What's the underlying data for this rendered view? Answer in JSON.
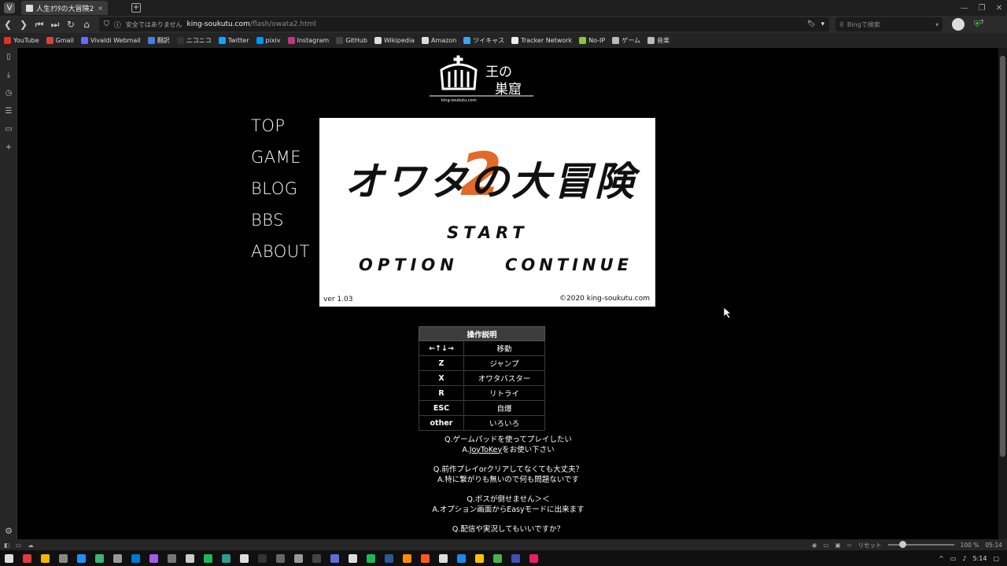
{
  "tab": {
    "title": "人生ｵﾜﾀの大冒険2",
    "close": "×",
    "new_tab": "+"
  },
  "window": {
    "minimize": "—",
    "maximize": "❐",
    "close": "✕"
  },
  "address": {
    "security_label": "安全ではありません",
    "url_host": "king-soukutu.com",
    "url_path": "/flash/owata2.html",
    "search_placeholder": "Bingで検索",
    "extension_badge": "3"
  },
  "bookmarks": [
    {
      "label": "YouTube",
      "color": "#e52d27"
    },
    {
      "label": "Gmail",
      "color": "#d44638"
    },
    {
      "label": "Vivaldi Webmail",
      "color": "#6a6af0"
    },
    {
      "label": "翻訳",
      "color": "#4a7de0"
    },
    {
      "label": "ニコニコ",
      "color": "#333333"
    },
    {
      "label": "Twitter",
      "color": "#1da1f2"
    },
    {
      "label": "pixiv",
      "color": "#0096fa"
    },
    {
      "label": "Instagram",
      "color": "#c13584"
    },
    {
      "label": "GitHub",
      "color": "#444444"
    },
    {
      "label": "Wikipedia",
      "color": "#dddddd"
    },
    {
      "label": "Amazon",
      "color": "#dddddd"
    },
    {
      "label": "ツイキャス",
      "color": "#3fa4f0"
    },
    {
      "label": "Tracker Network",
      "color": "#eeeeee"
    },
    {
      "label": "No-IP",
      "color": "#8bc34a"
    },
    {
      "label": "ゲーム",
      "color": "#bbbbbb"
    },
    {
      "label": "音楽",
      "color": "#bbbbbb"
    }
  ],
  "site": {
    "logo_text_top": "王の",
    "logo_text_bottom": "巣窟",
    "logo_domain": "king-soukutu.com",
    "nav": [
      "TOP",
      "GAME",
      "BLOG",
      "BBS",
      "ABOUT"
    ]
  },
  "game": {
    "title_text": "オワタの大冒険",
    "title_number": "2",
    "menu_start": "START",
    "menu_option": "OPTION",
    "menu_continue": "CONTINUE",
    "version": "ver 1.03",
    "copyright": "©2020  king-soukutu.com",
    "accent_color": "#e2611d"
  },
  "controls": {
    "header": "操作説明",
    "rows": [
      {
        "key": "←↑↓→",
        "action": "移動"
      },
      {
        "key": "Z",
        "action": "ジャンプ"
      },
      {
        "key": "X",
        "action": "オワタバスター"
      },
      {
        "key": "R",
        "action": "リトライ"
      },
      {
        "key": "ESC",
        "action": "自爆"
      },
      {
        "key": "other",
        "action": "いろいろ"
      }
    ]
  },
  "faq": [
    {
      "q": "Q.ゲームパッドを使ってプレイしたい",
      "a_pre": "A.",
      "a_link": "JoyToKey",
      "a_post": "をお使い下さい"
    },
    {
      "q": "Q.前作プレイorクリアしてなくても大丈夫？",
      "a_pre": "A.特に繋がりも無いので何も問題ないです",
      "a_link": "",
      "a_post": ""
    },
    {
      "q": "Q.ボスが倒せません＞＜",
      "a_pre": "A.オプション画面からEasyモードに出来ます",
      "a_link": "",
      "a_post": ""
    },
    {
      "q": "Q.配信や実況してもいいですか？",
      "a_pre": "",
      "a_link": "",
      "a_post": ""
    }
  ],
  "status": {
    "reset_label": "リセット",
    "zoom": "100 %",
    "time": "05:14"
  },
  "taskbar": {
    "clock": "5:14",
    "tray_arrow": "^"
  }
}
